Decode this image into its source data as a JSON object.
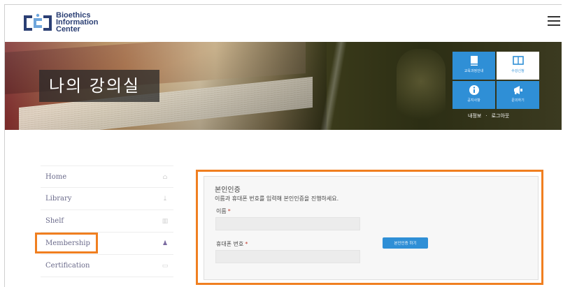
{
  "brand": {
    "line1": "Bioethics",
    "line2": "Information",
    "line3": "Center",
    "colors": {
      "logo_blue": "#2b3f74",
      "logo_bracket": "#6fa6dc"
    }
  },
  "banner": {
    "title": "나의 강의실",
    "quick_links": [
      {
        "label": "교육과정안내",
        "icon": "book-icon"
      },
      {
        "label": "수강신청",
        "icon": "open-book-icon"
      },
      {
        "label": "공지사항",
        "icon": "info-icon"
      },
      {
        "label": "문의하기",
        "icon": "megaphone-icon"
      }
    ],
    "user_links": {
      "profile": "내정보",
      "separator": "·",
      "logout": "로그아웃"
    }
  },
  "menu": [
    {
      "label": "Home",
      "icon": "home-icon"
    },
    {
      "label": "Library",
      "icon": "download-icon"
    },
    {
      "label": "Shelf",
      "icon": "shelf-icon"
    },
    {
      "label": "Membership",
      "icon": "users-icon"
    },
    {
      "label": "Certification",
      "icon": "graduation-cap-icon"
    }
  ],
  "verification": {
    "title": "본인인증",
    "description": "이름과 휴대폰 번호를 입력해 본인인증을 진행하세요.",
    "name_label": "이름",
    "name_value": "",
    "phone_label": "휴대폰 번호",
    "phone_value": "",
    "required_mark": "*",
    "button_label": "본인인증 하기"
  },
  "colors": {
    "accent_blue": "#2f8fd6",
    "highlight_orange": "#f07f20",
    "required_red": "#c0392b"
  }
}
